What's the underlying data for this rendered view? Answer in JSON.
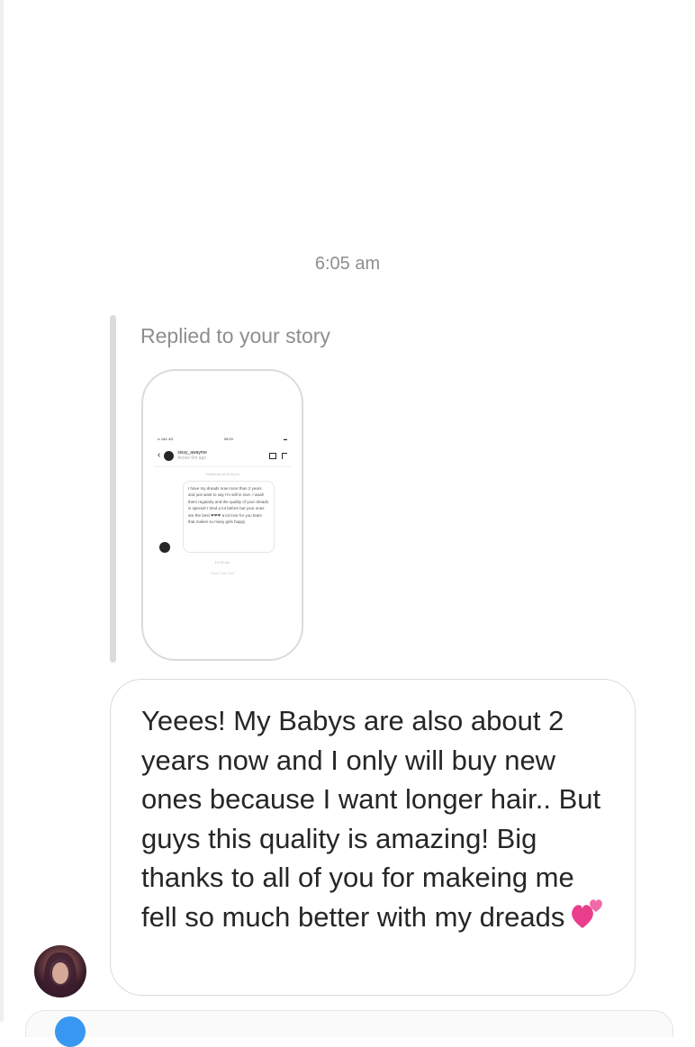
{
  "thread": {
    "timestamp": "6:05 am",
    "reply_label": "Replied to your story",
    "story_preview": {
      "status_left": "•• 1&1 4G",
      "status_time": "09:29",
      "status_right": "▬",
      "username": "sissy_awayme",
      "subline": "Active 6m ago",
      "date_line": "Yesterday at 8:16 pm",
      "message": "I have my dreads now more than 2 years and just want to say I'm still in love. I wash them regularly and the quality of your dreads is special! I tried a lot before but your ones are the best ❤❤❤ a lot love for you team that makes so many girls happy",
      "time_line": "10:49 am",
      "seen_line": "Seen Just now"
    },
    "message_text": "Yeees! My Babys are also about 2 years now and I only will buy new ones because I want longer hair.. But guys this quality is amazing! Big thanks to all of you for makeing me fell so much better with my dreads",
    "message_emoji": "💕"
  },
  "colors": {
    "muted_text": "#8e8e8e",
    "border": "#dbdbdb",
    "text": "#262626",
    "heart": "#e83e8c"
  }
}
